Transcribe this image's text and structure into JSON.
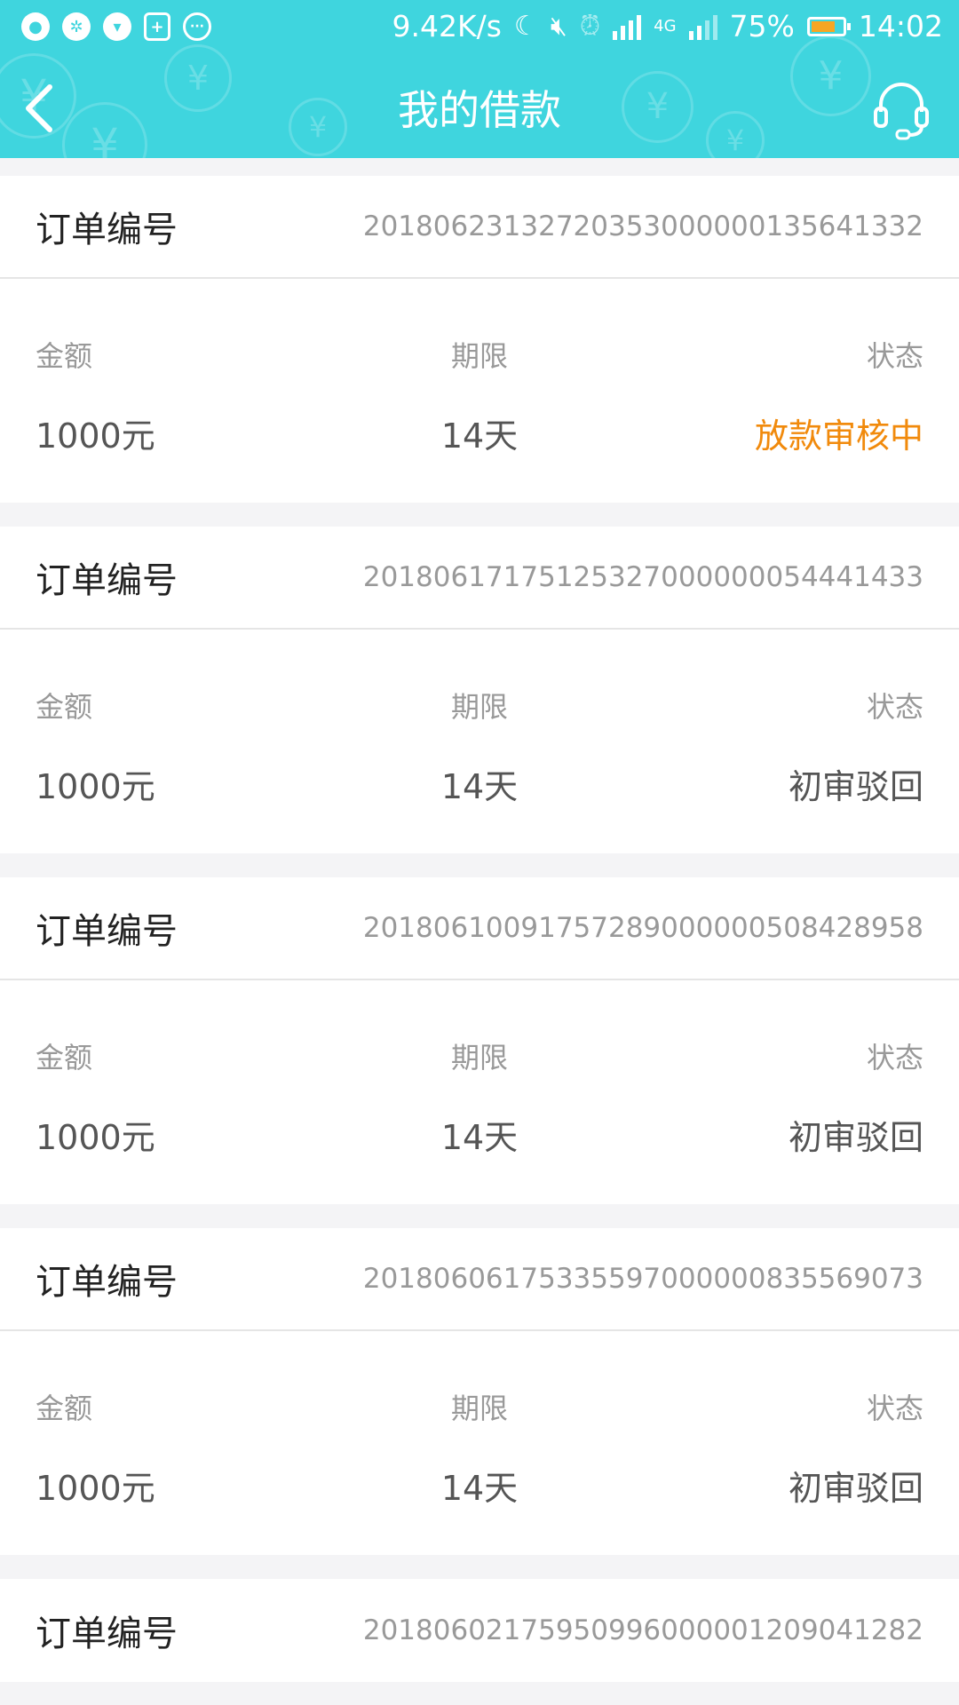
{
  "status_bar": {
    "net_speed": "9.42K/s",
    "network": "4G",
    "battery": "75%",
    "time": "14:02"
  },
  "header": {
    "title": "我的借款",
    "coin_symbol": "¥"
  },
  "labels": {
    "order": "订单编号",
    "amount": "金额",
    "term": "期限",
    "status": "状态"
  },
  "orders": [
    {
      "order_no": "20180623132720353000000135641332",
      "amount": "1000元",
      "term": "14天",
      "status": "放款审核中"
    },
    {
      "order_no": "20180617175125327000000054441433",
      "amount": "1000元",
      "term": "14天",
      "status": "初审驳回"
    },
    {
      "order_no": "20180610091757289000000508428958",
      "amount": "1000元",
      "term": "14天",
      "status": "初审驳回"
    },
    {
      "order_no": "20180606175335597000000835569073",
      "amount": "1000元",
      "term": "14天",
      "status": "初审驳回"
    },
    {
      "order_no": "20180602175950996000001209041282"
    }
  ],
  "colors": {
    "header_bg": "#3fd5de",
    "status_pending": "#f18a0c",
    "status_default": "#555555"
  }
}
